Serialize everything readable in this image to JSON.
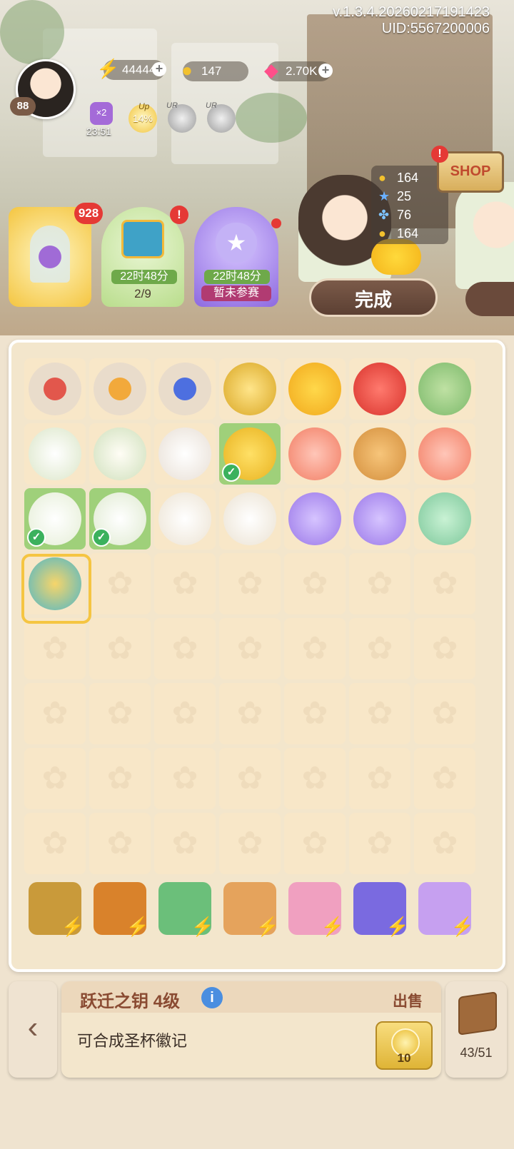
{
  "version": "v.1.3.4.20260217191423",
  "uid": "UID:5567200006",
  "player": {
    "level": "88"
  },
  "resources": {
    "energy": "44444",
    "coins": "147",
    "gems": "2.70K"
  },
  "buffs": {
    "boost_multiplier": "×2",
    "boost_timer": "23:51",
    "up_label": "Up",
    "up_percent": "14%",
    "ur_label_1": "UR",
    "ur_label_2": "UR"
  },
  "events": [
    {
      "badge": "928"
    },
    {
      "timer": "22时48分",
      "progress": "2/9"
    },
    {
      "timer": "22时48分",
      "status": "暂未参赛"
    }
  ],
  "order": {
    "rewards": [
      {
        "icon": "coin-icon",
        "value": "164"
      },
      {
        "icon": "star-icon",
        "value": "25"
      },
      {
        "icon": "butterfly-icon",
        "value": "76"
      },
      {
        "icon": "coin-icon",
        "value": "164"
      }
    ],
    "done_label": "完成"
  },
  "shop_label": "SHOP",
  "grid_items": [
    [
      "red-rose-dome",
      "gold-tree-dome",
      "blue-tree-dome",
      "gold-coins",
      "gold-gem",
      "red-gem",
      "cat-teacup"
    ],
    [
      "white-lily",
      "white-gardenia",
      "white-magnolia",
      "yellow-flowers-checked",
      "koi-fish",
      "waffle",
      "koi-fish"
    ],
    [
      "lily-cat-checked",
      "calla-lily-checked",
      "calla-pair",
      "calla-single",
      "purple-drop",
      "purple-drop",
      "green-drop"
    ],
    [
      "key-selected",
      "",
      "",
      "",
      "",
      "",
      ""
    ]
  ],
  "generators": [
    "cabinet",
    "teapot",
    "greenhouse",
    "flower-cart",
    "tea-set",
    "portal",
    "perfume-bottle"
  ],
  "info": {
    "item_name": "跃迁之钥 4级",
    "sell_label": "出售",
    "description": "可合成圣杯徽记",
    "price": "10"
  },
  "bag": {
    "count": "43/51"
  }
}
